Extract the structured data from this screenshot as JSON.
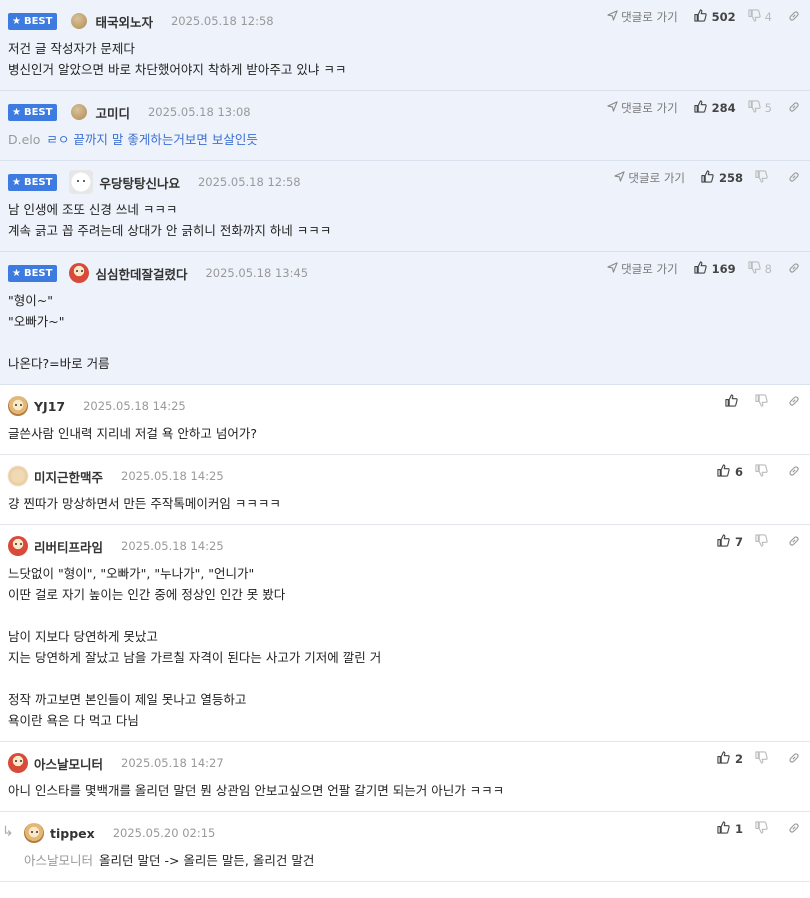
{
  "labels": {
    "best": "BEST",
    "reply_to": "댓글로 가기"
  },
  "colors": {
    "best_bg": "#eef3fb",
    "badge": "#3d7be0",
    "mention": "#999999",
    "body_blue": "#3d6fd1"
  },
  "comments": [
    {
      "best": true,
      "avatar": "round",
      "nick": "태국외노자",
      "date": "2025.05.18 12:58",
      "up": "502",
      "down": "4",
      "lines": [
        "저건 글 작성자가 문제다",
        "병신인거 알았으면 바로 차단했어야지 착하게 받아주고 있냐 ㅋㅋ"
      ]
    },
    {
      "best": true,
      "avatar": "round",
      "nick": "고미디",
      "date": "2025.05.18 13:08",
      "up": "284",
      "down": "5",
      "mention": "D.elo",
      "lines": [
        "ㄹㅇ 끝까지 말 좋게하는거보면 보살인듯"
      ]
    },
    {
      "best": true,
      "avatar": "white",
      "nick": "우당탕탕신나요",
      "date": "2025.05.18 12:58",
      "up": "258",
      "down": "",
      "lines": [
        "남 인생에 조또 신경 쓰네 ㅋㅋㅋ",
        "계속 긁고 꼽 주려는데 상대가 안 긁히니 전화까지 하네 ㅋㅋㅋ"
      ]
    },
    {
      "best": true,
      "avatar": "red",
      "nick": "심심한데잘걸렸다",
      "date": "2025.05.18 13:45",
      "up": "169",
      "down": "8",
      "lines": [
        "\"형이~\"",
        "\"오빠가~\"",
        "",
        "나온다?=바로 거름"
      ]
    },
    {
      "best": false,
      "avatar": "dog",
      "nick": "YJ17",
      "date": "2025.05.18 14:25",
      "up": "",
      "down": "",
      "lines": [
        "글쓴사람 인내력 지리네 저걸 욕 안하고 넘어가?"
      ]
    },
    {
      "best": false,
      "avatar": "blur",
      "nick": "미지근한맥주",
      "date": "2025.05.18 14:25",
      "up": "6",
      "down": "",
      "lines": [
        "걍 찐따가 망상하면서 만든 주작톡메이커임 ㅋㅋㅋㅋ"
      ]
    },
    {
      "best": false,
      "avatar": "red",
      "nick": "리버티프라임",
      "date": "2025.05.18 14:25",
      "up": "7",
      "down": "",
      "lines": [
        "느닷없이 \"형이\", \"오빠가\", \"누나가\", \"언니가\"",
        "이딴 걸로 자기 높이는 인간 중에 정상인 인간 못 봤다",
        "",
        "남이 지보다 당연하게 못났고",
        "지는 당연하게 잘났고 남을 가르칠 자격이 된다는 사고가 기저에 깔린 거",
        "",
        "정작 까고보면 본인들이 제일 못나고 열등하고",
        "욕이란 욕은 다 먹고 다님"
      ]
    },
    {
      "best": false,
      "avatar": "red",
      "nick": "아스날모니터",
      "date": "2025.05.18 14:27",
      "up": "2",
      "down": "",
      "lines": [
        "아니 인스타를 몇백개를 올리던 말던 뭔 상관임 안보고싶으면 언팔 갈기면 되는거 아닌가 ㅋㅋㅋ"
      ]
    },
    {
      "best": false,
      "reply": true,
      "avatar": "dog",
      "nick": "tippex",
      "date": "2025.05.20 02:15",
      "up": "1",
      "down": "",
      "mention": "아스날모니터",
      "lines": [
        "올리던 말던 -> 올리든 말든, 올리건 말건"
      ]
    }
  ]
}
